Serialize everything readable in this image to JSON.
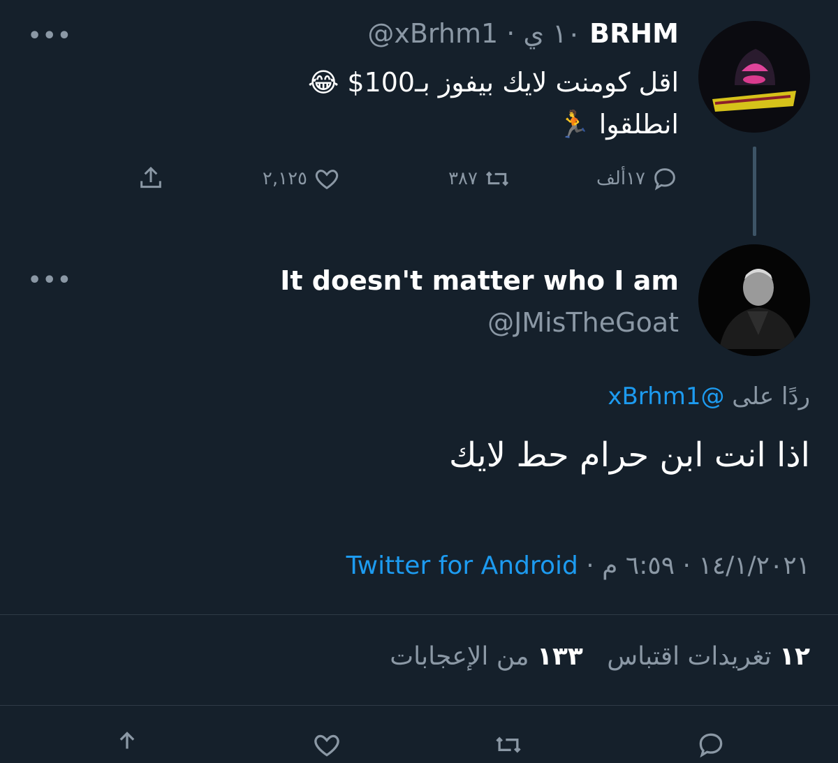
{
  "tweet1": {
    "display_name": "BRHM",
    "handle_time": "@xBrhm1 · ١٠ ي",
    "line1": "اقل كومنت لايك بيفوز بـ100$ 😂",
    "line2": "انطلقوا 🏃",
    "avatar_icon": "hooded-figure-logo",
    "reply_count": "١٧ألف",
    "retweet_count": "٣٨٧",
    "like_count": "٢,١٢٥"
  },
  "tweet2": {
    "display_name": "It doesn't matter who I am",
    "handle": "@JMisTheGoat",
    "avatar_icon": "man-in-dark-coat-photo",
    "reply_prefix": "ردًا على",
    "reply_to": "@xBrhm1",
    "text": "اذا انت ابن حرام حط لايك",
    "date_time": "١٤/١/٢٠٢١ · ٦:٥٩ م ·",
    "source": "Twitter for Android",
    "quote_count": "١٢",
    "quote_label": "تغريدات اقتباس",
    "like_count": "١٣٣",
    "like_label": "من الإعجابات"
  },
  "colors": {
    "background": "#15202b",
    "accent": "#1d9bf0",
    "muted": "#8b98a5",
    "divider": "#2f3b47"
  }
}
